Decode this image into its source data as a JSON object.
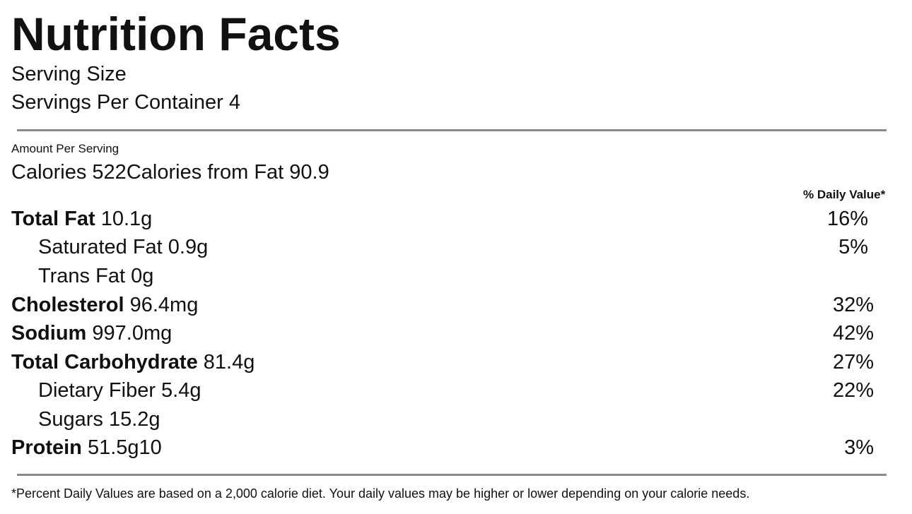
{
  "label": {
    "title": "Nutrition Facts",
    "serving_size": "Serving Size",
    "servings_per_container": "Servings Per Container 4",
    "amount_per_serving": "Amount Per Serving",
    "calories": "Calories 522",
    "calories_from_fat": "Calories from Fat 90.9",
    "daily_value_header": "% Daily Value*",
    "nutrients": [
      {
        "name": "Total Fat",
        "amount": " 10.1g",
        "daily_value": "16%"
      },
      {
        "name": "Saturated Fat 0.9g",
        "amount": "",
        "daily_value": "5%"
      },
      {
        "name": "Trans Fat 0g",
        "amount": "",
        "daily_value": ""
      },
      {
        "name": "Cholesterol",
        "amount": " 96.4mg",
        "daily_value": "32%"
      },
      {
        "name": "Sodium",
        "amount": " 997.0mg",
        "daily_value": "42%"
      },
      {
        "name": "Total Carbohydrate",
        "amount": " 81.4g",
        "daily_value": "27%"
      },
      {
        "name": "Dietary Fiber 5.4g",
        "amount": "",
        "daily_value": "22%"
      },
      {
        "name": "Sugars 15.2g",
        "amount": "",
        "daily_value": ""
      },
      {
        "name": "Protein",
        "amount": " 51.5g10",
        "daily_value": "3%"
      }
    ],
    "footnote": "*Percent Daily Values are based on a 2,000 calorie diet. Your daily values may be higher or lower depending on your calorie needs."
  }
}
